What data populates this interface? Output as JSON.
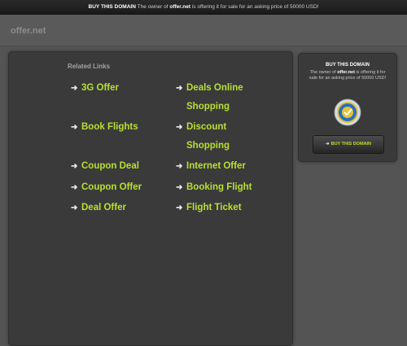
{
  "topbar": {
    "label": "BUY THIS DOMAIN",
    "text_before": "The owner of",
    "domain": "offer.net",
    "text_after": "is offering it for sale for an asking price of 50000 USD!"
  },
  "header": {
    "logo": "offer.net"
  },
  "related": {
    "title": "Related Links",
    "links": [
      {
        "label": "3G Offer"
      },
      {
        "label": "Deals Online",
        "label2": "Shopping"
      },
      {
        "label": "Book Flights"
      },
      {
        "label": "Discount",
        "label2": "Shopping"
      },
      {
        "label": "Coupon Deal"
      },
      {
        "label": "Internet Offer"
      },
      {
        "label": "Coupon Offer"
      },
      {
        "label": "Booking Flight"
      },
      {
        "label": "Deal Offer"
      },
      {
        "label": "Flight Ticket"
      }
    ]
  },
  "sidebar": {
    "title": "BUY THIS DOMAIN",
    "text_before": "The owner of",
    "domain": "offer.net",
    "text_after": "is offering it for sale for an asking price of 50000 USD!",
    "button_label": "BUY THIS DOMAIN",
    "badge_icon": "verified-seal-icon"
  },
  "colors": {
    "link": "#b9e030",
    "background": "#545454",
    "panel": "#3a3a3a"
  }
}
